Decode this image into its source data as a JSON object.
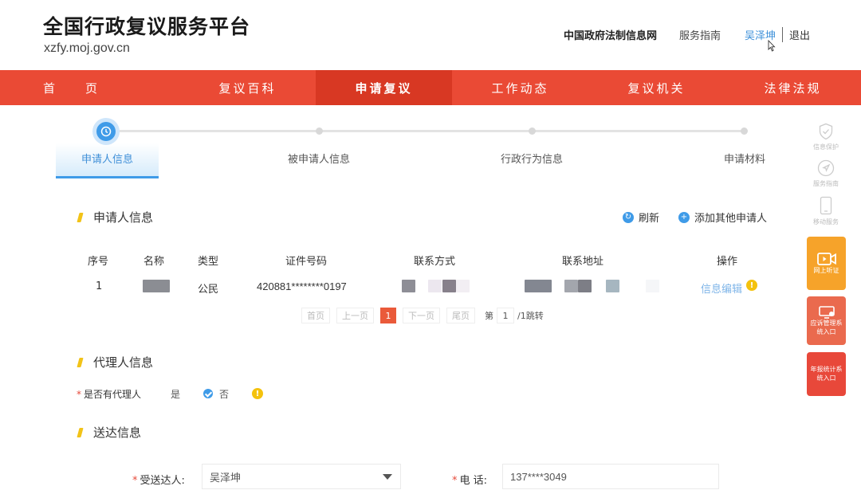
{
  "header": {
    "title": "全国行政复议服务平台",
    "domain": "xzfy.moj.gov.cn",
    "links": {
      "gov_site": "中国政府法制信息网",
      "guide": "服务指南",
      "user": "吴泽坤",
      "exit": "退出"
    }
  },
  "nav": {
    "items": [
      "首页",
      "复议百科",
      "申请复议",
      "工作动态",
      "复议机关",
      "法律法规"
    ],
    "active_index": 2
  },
  "steps": {
    "items": [
      "申请人信息",
      "被申请人信息",
      "行政行为信息",
      "申请材料"
    ],
    "current": 0
  },
  "applicant_section": {
    "title": "申请人信息",
    "refresh": "刷新",
    "add_other": "添加其他申请人",
    "columns": [
      "序号",
      "名称",
      "类型",
      "证件号码",
      "联系方式",
      "联系地址",
      "操作"
    ],
    "rows": [
      {
        "index": "1",
        "type": "公民",
        "id_number": "420881********0197",
        "action": "信息编辑"
      }
    ],
    "pagination": {
      "first": "首页",
      "prev": "上一页",
      "current": "1",
      "next": "下一页",
      "last": "尾页",
      "page_prefix": "第",
      "page_input": "1",
      "page_suffix": "/1跳转"
    }
  },
  "agent_section": {
    "title": "代理人信息",
    "question": "是否有代理人",
    "option_yes": "是",
    "option_no": "否",
    "selected": "否"
  },
  "delivery_section": {
    "title": "送达信息",
    "recipient_label": "受送达人:",
    "recipient_value": "吴泽坤",
    "phone_label": "电 话:",
    "phone_value": "137****3049"
  },
  "sidebar": {
    "items": [
      "信息保护",
      "服务指南",
      "移动服务"
    ],
    "cards": [
      {
        "label": "网上听证",
        "color": "#f6a32a"
      },
      {
        "label": "应诉管理系统入口",
        "color": "#ea6a4e"
      },
      {
        "label": "年报统计系统入口",
        "color": "#e8483a"
      }
    ]
  },
  "colors": {
    "nav_bg": "#ea4a35",
    "accent_blue": "#3f9be8",
    "mark_yellow": "#f2c318"
  }
}
